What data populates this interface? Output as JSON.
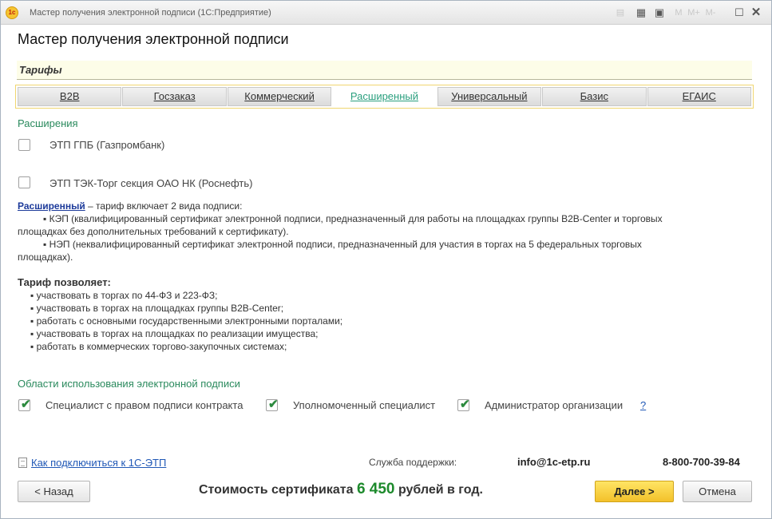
{
  "window": {
    "title": "Мастер получения электронной подписи  (1С:Предприятие)",
    "logo_text": "1с",
    "toolbar_icons": [
      "document-icon",
      "calculator-icon",
      "calendar-icon",
      "memory-icon",
      "minimize-icon",
      "maximize-icon",
      "close-icon"
    ],
    "memory_buttons": [
      "M",
      "M+",
      "M-"
    ]
  },
  "page": {
    "title": "Мастер получения электронной подписи",
    "tariffs_header": "Тарифы"
  },
  "tabs": [
    {
      "label": "B2B",
      "active": false
    },
    {
      "label": "Госзаказ",
      "active": false
    },
    {
      "label": "Коммерческий",
      "active": false
    },
    {
      "label": "Расширенный",
      "active": true
    },
    {
      "label": "Универсальный",
      "active": false
    },
    {
      "label": "Базис",
      "active": false
    },
    {
      "label": "ЕГАИС",
      "active": false
    }
  ],
  "extensions": {
    "label": "Расширения",
    "items": [
      {
        "label": "ЭТП ГПБ (Газпромбанк)",
        "checked": false
      },
      {
        "label": "ЭТП ТЭК-Торг секция ОАО НК (Роснефть)",
        "checked": false
      }
    ]
  },
  "description": {
    "tariff_link": "Расширенный",
    "intro": " – тариф включает 2 вида подписи:",
    "kep": "▪ КЭП (квалифицированный сертификат электронной подписи, предназначенный для работы на площадках группы B2B-Center и торговых",
    "kep_cont": "площадках без дополнительных требований к сертификату).",
    "nep": "▪ НЭП (неквалифицированный сертификат электронной подписи, предназначенный для участия в торгах на 5 федеральных торговых",
    "nep_cont": "площадках).",
    "allows_title": "Тариф позволяет:",
    "allows": [
      "▪ участвовать в торгах по 44-ФЗ и 223-ФЗ;",
      "▪ участвовать в торгах на площадках группы B2B-Center;",
      "▪ работать с основными государственными электронными порталами;",
      "▪ участвовать в торгах на площадках по реализации имущества;",
      "▪ работать в коммерческих торгово-закупочных системах;"
    ]
  },
  "usage": {
    "label": "Области использования электронной подписи",
    "items": [
      {
        "label": "Специалист с правом подписи контракта",
        "checked": true
      },
      {
        "label": "Уполномоченный специалист",
        "checked": true
      },
      {
        "label": "Администратор организации",
        "checked": true
      }
    ],
    "help": "?"
  },
  "footer": {
    "howto_link": "Как подключиться к 1С-ЭТП",
    "support_label": "Служба поддержки:",
    "support_email": "info@1c-etp.ru",
    "support_phone": "8-800-700-39-84",
    "back_button": "< Назад",
    "price_prefix": "Стоимость сертификата ",
    "price_amount": "6 450",
    "price_suffix": " рублей в год.",
    "next_button": "Далее >",
    "cancel_button": "Отмена"
  },
  "colors": {
    "accent_green": "#2a8a5d",
    "active_tab": "#2a9f7e",
    "price_green": "#1d8a2c",
    "primary_button": "#f3c12a",
    "link_blue": "#2058b6"
  }
}
